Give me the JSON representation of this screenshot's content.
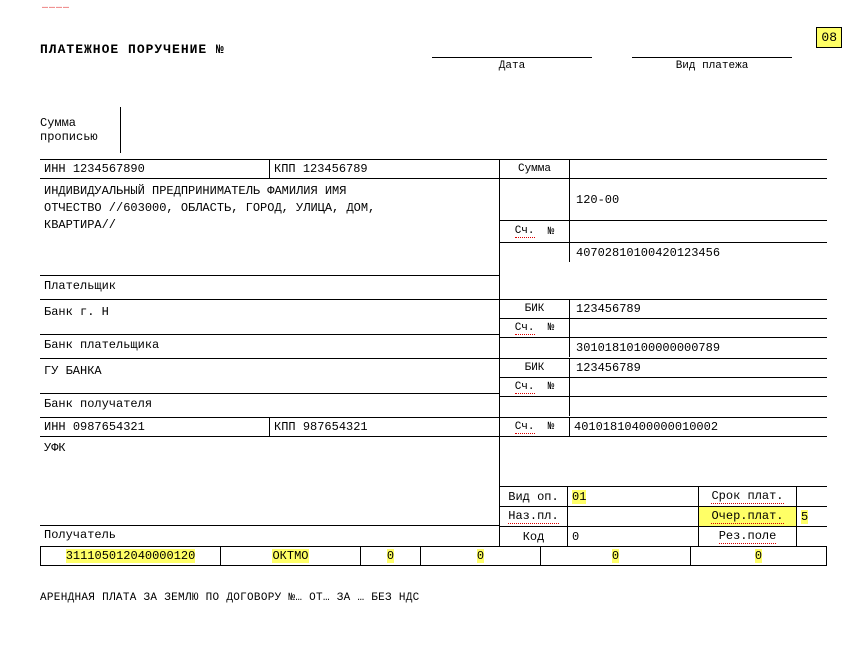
{
  "header": {
    "form_code": "08",
    "title": "ПЛАТЕЖНОЕ ПОРУЧЕНИЕ №",
    "date_label": "Дата",
    "payment_type_label": "Вид платежа",
    "sum_words_label1": "Сумма",
    "sum_words_label2": "прописью"
  },
  "payer": {
    "inn_label": "ИНН",
    "inn": "1234567890",
    "kpp_label": "КПП",
    "kpp": "123456789",
    "description_line1": "ИНДИВИДУАЛЬНЫЙ ПРЕДПРИНИМАТЕЛЬ ФАМИЛИЯ ИМЯ",
    "description_line2": "ОТЧЕСТВО //603000, ОБЛАСТЬ, ГОРОД, УЛИЦА, ДОМ,",
    "description_line3": "КВАРТИРА//",
    "payer_label": "Плательщик",
    "bank_name": "Банк г. Н",
    "bank_label": "Банк плательщика",
    "sum_label": "Сумма",
    "sum_value": "120-00",
    "acct_label": "Сч.",
    "acct_sub": "№",
    "acct_value": "40702810100420123456",
    "bik_label": "БИК",
    "bik_value": "123456789",
    "bank_acct_value": "30101810100000000789"
  },
  "recipient": {
    "bank_name": "ГУ БАНКА",
    "bank_label": "Банк получателя",
    "bik_label": "БИК",
    "bik_value": "123456789",
    "acct_label": "Сч.",
    "acct_sub": "№",
    "acct_top_value": "",
    "inn_label": "ИНН",
    "inn": "0987654321",
    "kpp_label": "КПП",
    "kpp": "987654321",
    "name": "УФК",
    "acct_value": "40101810400000010002",
    "recipient_label": "Получатель"
  },
  "footer_labels": {
    "vid_op": "Вид оп.",
    "naz_pl": "Наз.пл.",
    "kod": "Код",
    "srok_plat": "Срок плат.",
    "ocher_plat": "Очер.плат.",
    "rez_pole": "Рез.поле"
  },
  "footer_values": {
    "vid_op": "01",
    "ocher_plat": "5",
    "kod": "0"
  },
  "bottom_strip": {
    "c1": "311105012040000120",
    "c2": "ОКТМО",
    "c3": "0",
    "c4": "0",
    "c5": "0",
    "c6": "0"
  },
  "purpose": "АРЕНДНАЯ ПЛАТА ЗА ЗЕМЛЮ ПО ДОГОВОРУ №…   ОТ…   ЗА … БЕЗ НДС"
}
